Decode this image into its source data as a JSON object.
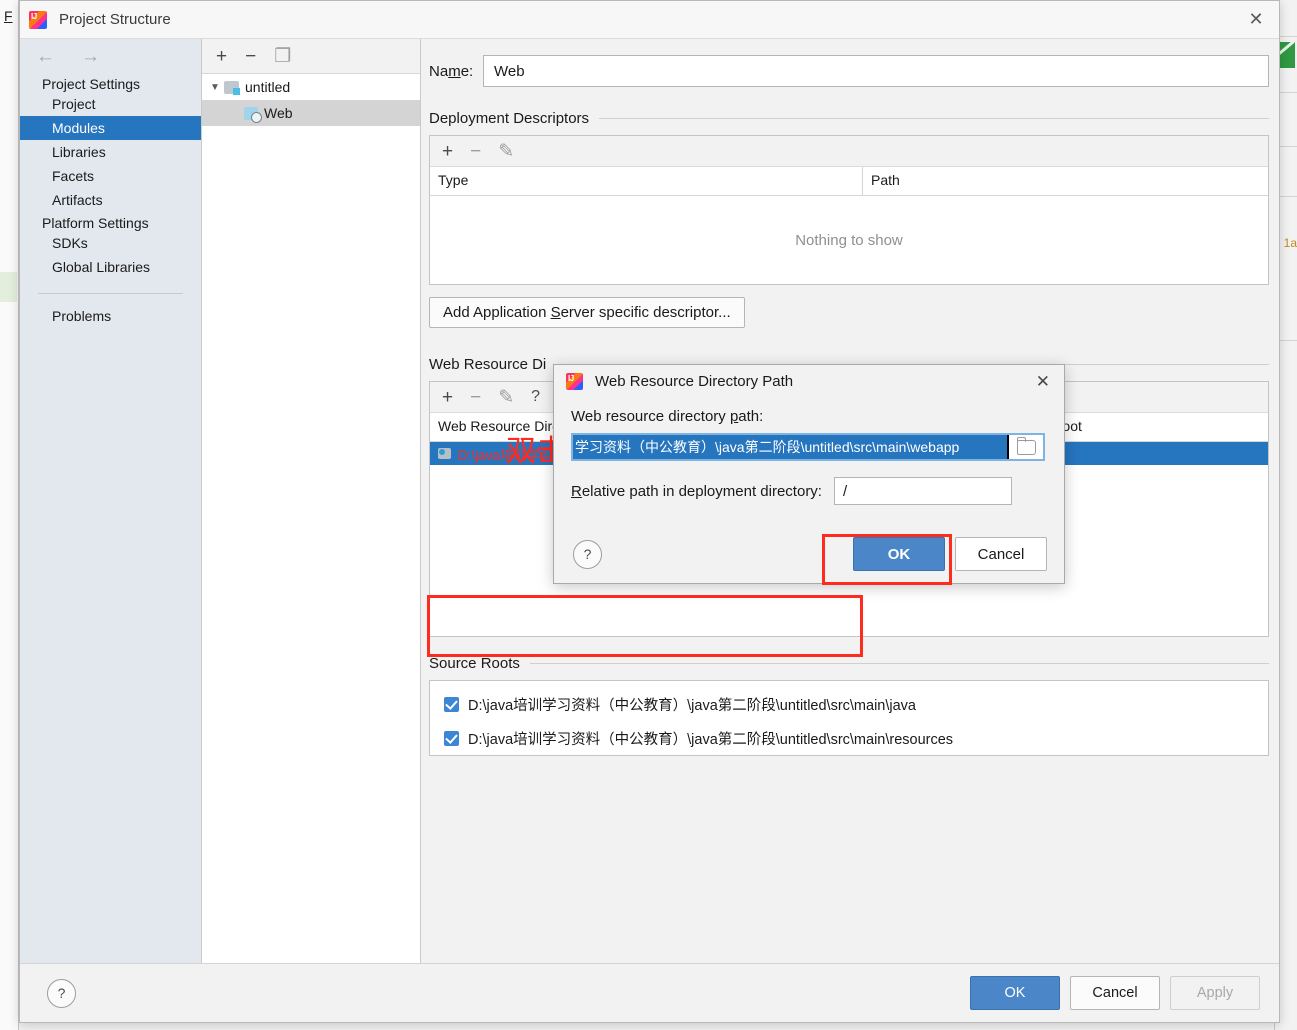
{
  "background": {
    "file_menu": "F",
    "right_edge_text": "1a"
  },
  "window": {
    "title": "Project Structure",
    "icon": "intellij-idea-icon",
    "close_icon": "close-icon"
  },
  "sidebar": {
    "back_icon": "arrow-left-icon",
    "forward_icon": "arrow-right-icon",
    "groups": [
      {
        "label": "Project Settings",
        "items": [
          {
            "label": "Project",
            "selected": false
          },
          {
            "label": "Modules",
            "selected": true
          },
          {
            "label": "Libraries",
            "selected": false
          },
          {
            "label": "Facets",
            "selected": false
          },
          {
            "label": "Artifacts",
            "selected": false
          }
        ]
      },
      {
        "label": "Platform Settings",
        "items": [
          {
            "label": "SDKs",
            "selected": false
          },
          {
            "label": "Global Libraries",
            "selected": false
          }
        ]
      }
    ],
    "problems": "Problems"
  },
  "tree": {
    "toolbar": [
      {
        "name": "add-module-button",
        "glyph": "+"
      },
      {
        "name": "remove-module-button",
        "glyph": "−"
      },
      {
        "name": "copy-module-button",
        "glyph": "❐"
      }
    ],
    "nodes": [
      {
        "label": "untitled",
        "icon": "module-folder-icon",
        "expanded": true,
        "selected": false
      },
      {
        "label": "Web",
        "icon": "web-facet-icon",
        "expanded": false,
        "selected": true
      }
    ]
  },
  "main": {
    "name_label": "Name:",
    "name_value": "Web",
    "deployment_descriptors": {
      "title": "Deployment Descriptors",
      "toolbar": [
        {
          "name": "add-descriptor-button",
          "glyph": "+"
        },
        {
          "name": "remove-descriptor-button",
          "glyph": "−"
        },
        {
          "name": "edit-descriptor-button",
          "glyph": "✎"
        }
      ],
      "columns": [
        "Type",
        "Path"
      ],
      "rows": [],
      "empty_text": "Nothing to show"
    },
    "add_descriptor_button": "Add Application Server specific descriptor...",
    "web_resource_directories": {
      "title_visible": "Web Resource Di",
      "title_full": "Web Resource Directories",
      "toolbar": [
        {
          "name": "add-web-resource-button",
          "glyph": "+"
        },
        {
          "name": "remove-web-resource-button",
          "glyph": "−"
        },
        {
          "name": "edit-web-resource-button",
          "glyph": "✎"
        },
        {
          "name": "help-web-resource-button",
          "glyph": "?"
        }
      ],
      "columns": [
        "Web Resource Directory",
        "Path Relative to Deployment Root"
      ],
      "rows": [
        {
          "directory": "D:\\java培训学习资料（中公教育）\\java第二阶段\\untitled...",
          "relative_path": "/",
          "selected": true,
          "icon": "directory-icon"
        }
      ],
      "annotation": "双击"
    },
    "source_roots": {
      "title": "Source Roots",
      "rows": [
        {
          "checked": true,
          "path": "D:\\java培训学习资料（中公教育）\\java第二阶段\\untitled\\src\\main\\java"
        },
        {
          "checked": true,
          "path": "D:\\java培训学习资料（中公教育）\\java第二阶段\\untitled\\src\\main\\resources"
        }
      ]
    }
  },
  "footer": {
    "help": "?",
    "ok": "OK",
    "cancel": "Cancel",
    "apply": "Apply"
  },
  "subdialog": {
    "title": "Web Resource Directory Path",
    "icon": "intellij-idea-icon",
    "close_icon": "close-icon",
    "path_label": "Web resource directory path:",
    "path_value": "学习资料（中公教育）\\java第二阶段\\untitled\\src\\main\\webapp",
    "browse_icon": "folder-browse-icon",
    "relative_label": "Relative path in deployment directory:",
    "relative_value": "/",
    "help": "?",
    "ok": "OK",
    "cancel": "Cancel"
  },
  "colors": {
    "selection_blue": "#2675bf",
    "primary_button": "#4a86c8",
    "annotation_red": "#fe2b1f",
    "sidebar_bg": "#e3e8ee"
  }
}
